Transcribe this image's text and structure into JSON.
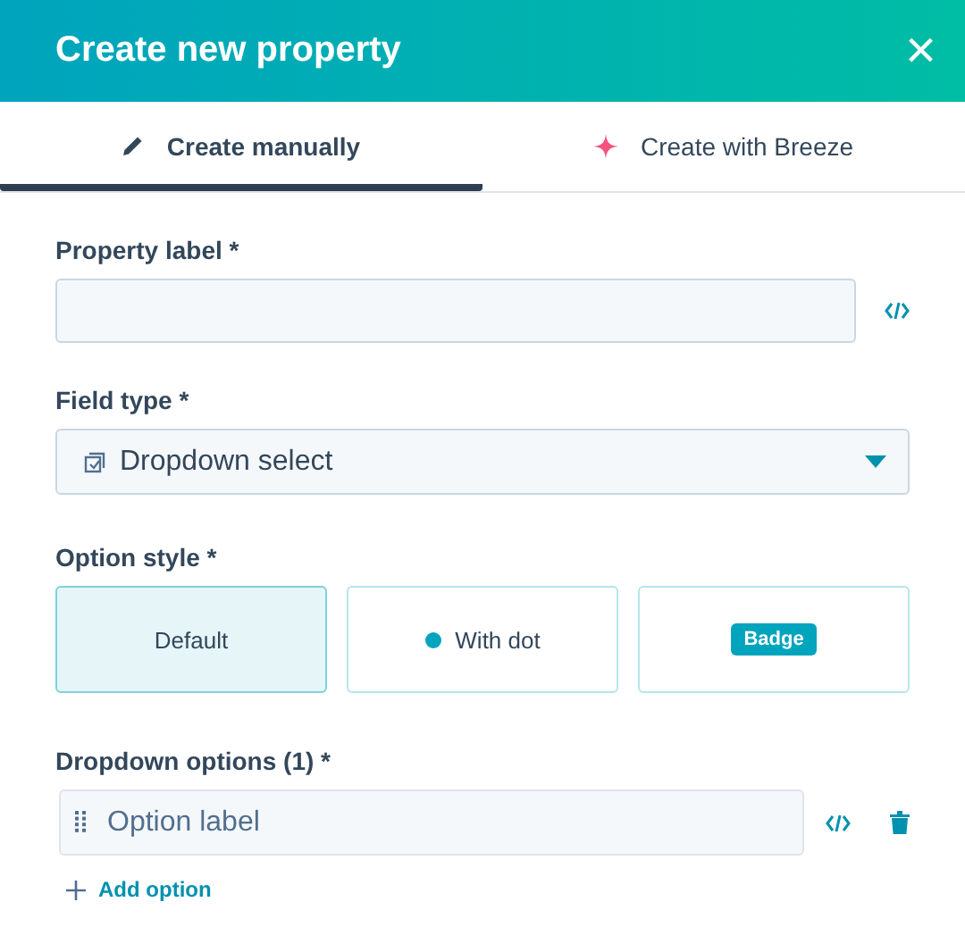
{
  "header": {
    "title": "Create new property",
    "close": "×"
  },
  "tabs": [
    {
      "label": "Create manually",
      "selected": true,
      "kind": "pencil"
    },
    {
      "label": "Create with Breeze",
      "selected": false,
      "kind": "sparkle"
    }
  ],
  "property_label": {
    "label": "Property label *"
  },
  "field_type": {
    "label": "Field type *",
    "value": "Dropdown select"
  },
  "option_style": {
    "label": "Option style *",
    "options": [
      {
        "label": "Default",
        "kind": "plain",
        "selected": true
      },
      {
        "label": "With dot",
        "kind": "dot",
        "selected": false
      },
      {
        "label": "Badge",
        "kind": "badge",
        "selected": false
      }
    ]
  },
  "dropdown_options": {
    "label": "Dropdown options (1) *",
    "items": [
      {
        "placeholder": "Option label"
      }
    ],
    "add": "Add option"
  }
}
